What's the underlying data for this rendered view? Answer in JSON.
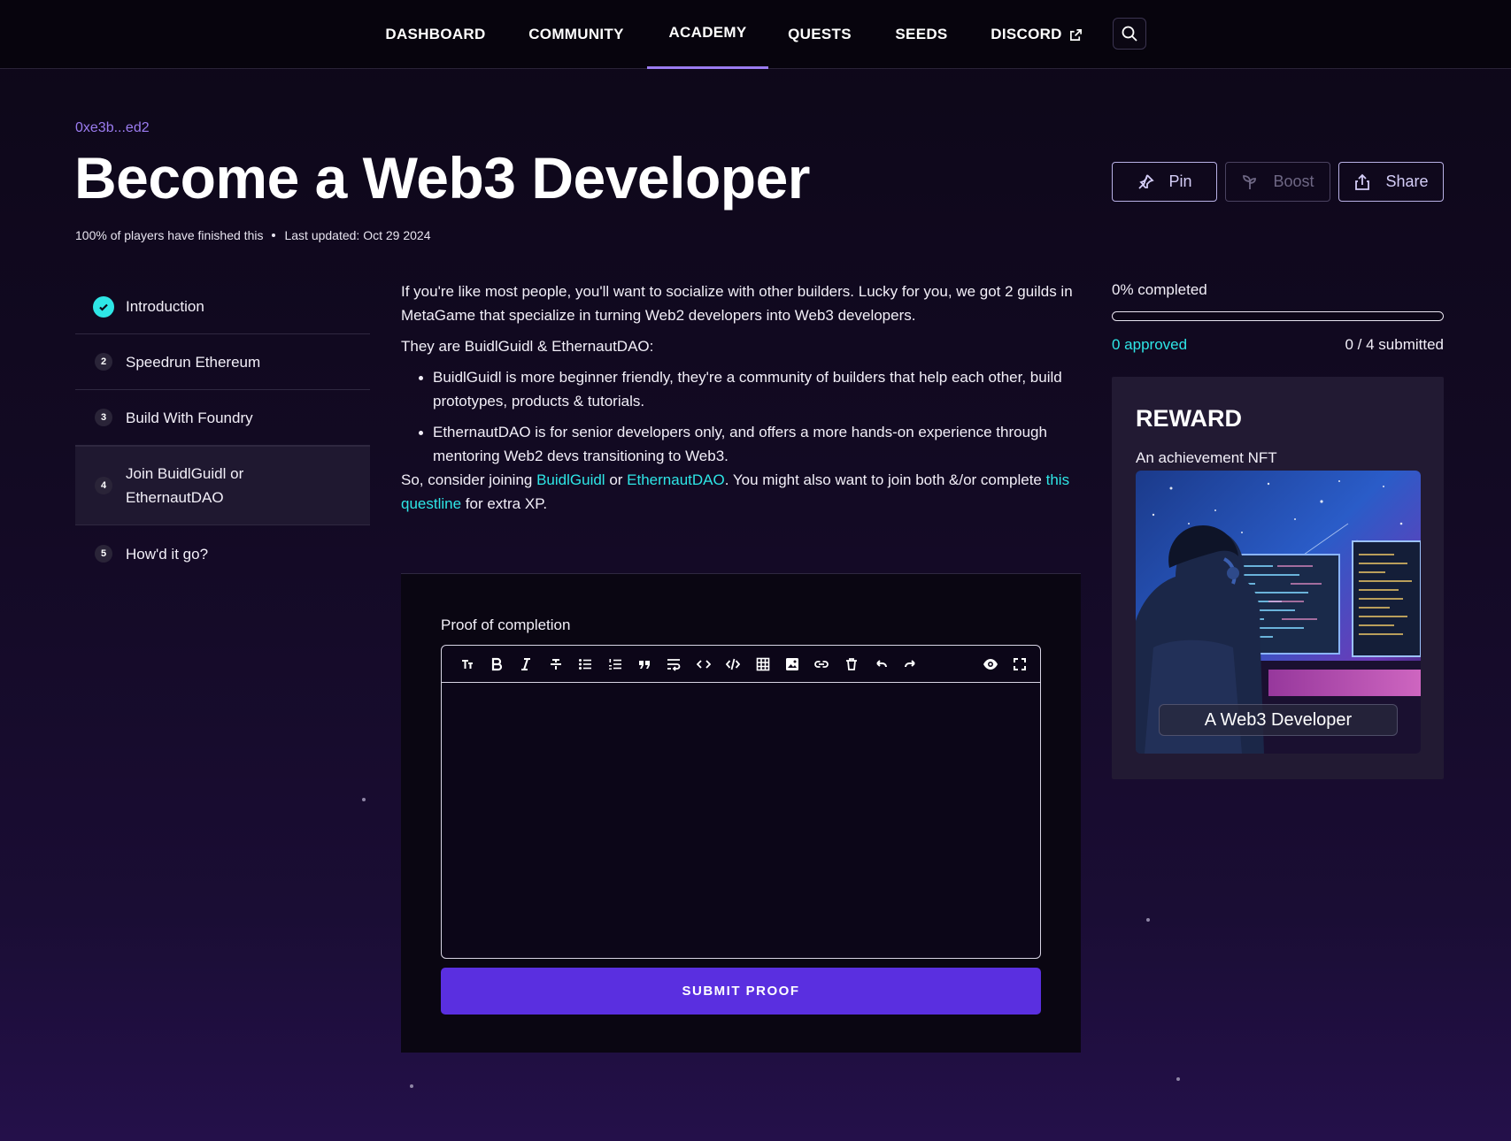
{
  "nav": {
    "items": [
      {
        "label": "DASHBOARD"
      },
      {
        "label": "COMMUNITY"
      },
      {
        "label": "ACADEMY",
        "active": true
      },
      {
        "label": "QUESTS"
      },
      {
        "label": "SEEDS"
      },
      {
        "label": "DISCORD",
        "icon": "external-link-icon"
      }
    ],
    "search_icon": "search-icon"
  },
  "header": {
    "address": "0xe3b...ed2",
    "title": "Become a Web3 Developer",
    "finished_text": "100% of players have finished this",
    "last_updated": "Last updated: Oct 29 2024"
  },
  "actions": {
    "pin": {
      "label": "Pin",
      "icon": "pin-icon"
    },
    "boost": {
      "label": "Boost",
      "icon": "sprout-icon",
      "disabled": true
    },
    "share": {
      "label": "Share",
      "icon": "share-icon"
    }
  },
  "steps": [
    {
      "badge": "",
      "label": "Introduction",
      "done": true
    },
    {
      "badge": "2",
      "label": "Speedrun Ethereum"
    },
    {
      "badge": "3",
      "label": "Build With Foundry"
    },
    {
      "badge": "4",
      "label": "Join BuidlGuidl or EthernautDAO",
      "current": true
    },
    {
      "badge": "5",
      "label": "How'd it go?"
    }
  ],
  "content": {
    "p1": "If you're like most people, you'll want to socialize with other builders. Lucky for you, we got 2 guilds in MetaGame that specialize in turning Web2 developers into Web3 developers.",
    "p2": "They are BuidlGuidl & EthernautDAO:",
    "bullet1": "BuidlGuidl is more beginner friendly, they're a community of builders that help each other, build prototypes, products & tutorials.",
    "bullet2": "EthernautDAO is for senior developers only, and offers a more hands-on experience through mentoring Web2 devs transitioning to Web3.",
    "p3_a": "So, consider joining ",
    "link_buidlguidl": "BuidlGuidl",
    "p3_b": " or ",
    "link_ethernaut": "EthernautDAO",
    "p3_c": ". You might also want to join both &/or complete ",
    "link_questline": "this questline",
    "p3_d": " for extra XP."
  },
  "proof": {
    "label": "Proof of completion",
    "editor_value": "",
    "toolbar": [
      "heading-icon",
      "bold-icon",
      "italic-icon",
      "strikethrough-icon",
      "bullet-list-icon",
      "numbered-list-icon",
      "quote-icon",
      "wrap-icon",
      "code-icon",
      "code-block-icon",
      "table-icon",
      "image-icon",
      "link-icon",
      "delete-icon",
      "undo-icon",
      "redo-icon"
    ],
    "toolbar_right": [
      "preview-eye-icon",
      "fullscreen-icon"
    ],
    "submit_label": "SUBMIT PROOF"
  },
  "progress": {
    "completed_text": "0% completed",
    "percent": 0,
    "approved_text": "0 approved",
    "submitted_text": "0 / 4 submitted"
  },
  "reward": {
    "title": "REWARD",
    "description": "An achievement NFT",
    "nft_caption": "A Web3 Developer"
  },
  "colors": {
    "accent_purple": "#5a2fe0",
    "link_cyan": "#2ee6e6",
    "nav_underline": "#9b7cf0"
  }
}
